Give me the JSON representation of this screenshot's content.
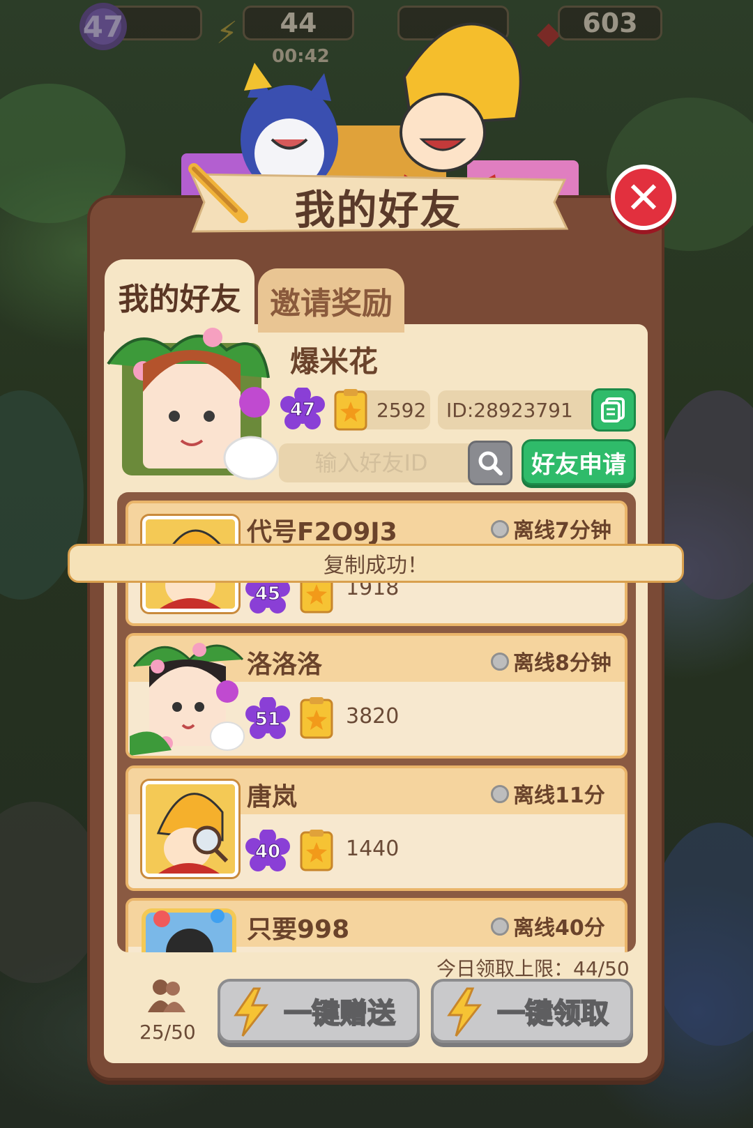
{
  "hud": {
    "level": "47",
    "energy": "44",
    "energy_timer": "00:42",
    "gems": "603"
  },
  "dialog": {
    "title": "我的好友",
    "close_icon": "close-icon"
  },
  "tabs": [
    {
      "label": "我的好友",
      "active": true
    },
    {
      "label": "邀请奖励",
      "active": false
    }
  ],
  "profile": {
    "name": "爆米花",
    "level": "47",
    "score": "2592",
    "id_text": "ID:28923791"
  },
  "search": {
    "placeholder": "输入好友ID",
    "apply_label": "好友申请"
  },
  "toast": {
    "text": "复制成功！"
  },
  "friends": [
    {
      "name": "代号F2O9J3",
      "status": "离线7分钟",
      "level": "45",
      "score": "1918"
    },
    {
      "name": "洛洛洛",
      "status": "离线8分钟",
      "level": "51",
      "score": "3820"
    },
    {
      "name": "唐岚",
      "status": "离线11分",
      "level": "40",
      "score": "1440"
    },
    {
      "name": "只要998",
      "status": "离线40分",
      "level": "",
      "score": ""
    }
  ],
  "footer": {
    "limit_text": "今日领取上限：44/50",
    "friend_count": "25/50",
    "send_all_label": "一键赠送",
    "claim_all_label": "一键领取"
  },
  "colors": {
    "panel": "#7a4a36",
    "panel_inner": "#f6e6c6",
    "green_button": "#2fbb6a",
    "close_red": "#e2303e",
    "level_purple": "#8a3fd6",
    "disabled_gray": "#c9c9cb"
  }
}
